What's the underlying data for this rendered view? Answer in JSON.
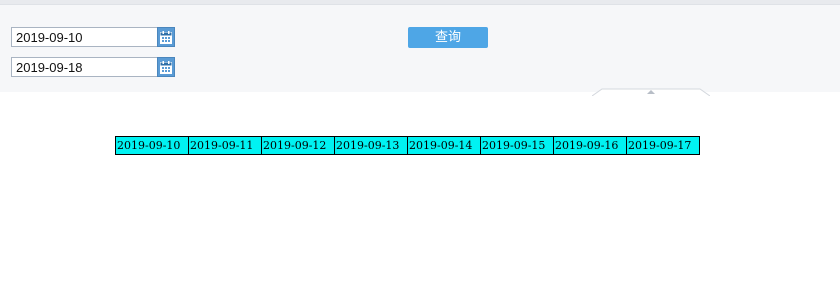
{
  "filters": {
    "start_date": "2019-09-10",
    "end_date": "2019-09-18",
    "query_button_label": "查询"
  },
  "dates_table": {
    "cells": [
      "2019-09-10",
      "2019-09-11",
      "2019-09-12",
      "2019-09-13",
      "2019-09-14",
      "2019-09-15",
      "2019-09-16",
      "2019-09-17"
    ]
  },
  "icons": {
    "calendar": "calendar-icon",
    "collapse": "chevron-up-icon"
  },
  "colors": {
    "query_button": "#4ea6e6",
    "calendar_button": "#5a9bd5",
    "table_cell_bg": "#00f2f2",
    "panel_bg": "#f6f7f9"
  }
}
